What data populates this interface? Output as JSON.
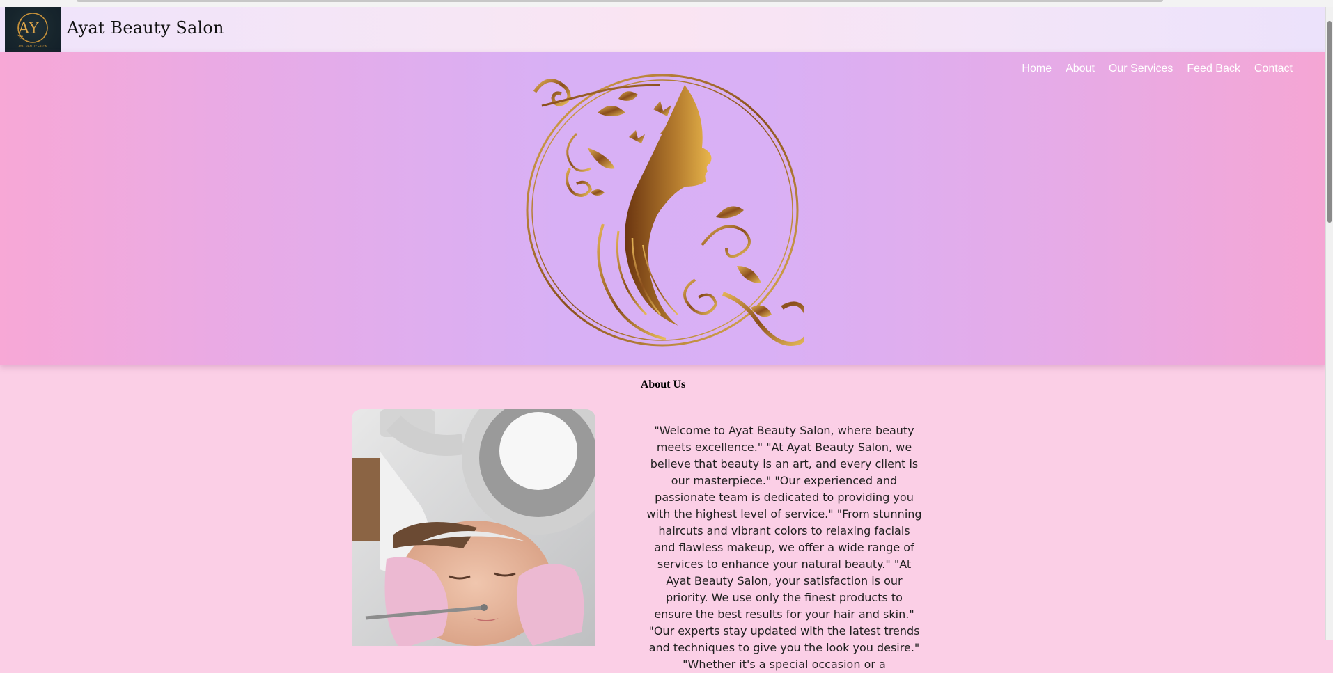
{
  "brand": {
    "name": "Ayat Beauty Salon",
    "logo_letters": "AY",
    "logo_caption": "AYAT BEAUTY SALON"
  },
  "nav": {
    "items": [
      "Home",
      "About",
      "Our Services",
      "Feed Back",
      "Contact"
    ]
  },
  "about": {
    "title": "About Us",
    "text": "\"Welcome to Ayat Beauty Salon, where beauty meets excellence.\" \"At Ayat Beauty Salon, we believe that beauty is an art, and every client is our masterpiece.\" \"Our experienced and passionate team is dedicated to providing you with the highest level of service.\" \"From stunning haircuts and vibrant colors to relaxing facials and flawless makeup, we offer a wide range of services to enhance your natural beauty.\" \"At Ayat Beauty Salon, your satisfaction is our priority. We use only the finest products to ensure the best results for your hair and skin.\" \"Our experts stay updated with the latest trends and techniques to give you the look you desire.\" \"Whether it's a special occasion or a"
  },
  "colors": {
    "gold": "#c8923a",
    "hero_pink": "#f7a8d6",
    "hero_lavender": "#d8b0f5",
    "page_bg": "#fbcfe6"
  }
}
